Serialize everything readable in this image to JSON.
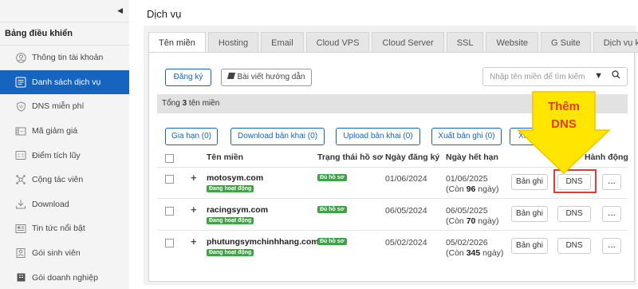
{
  "sidebar": {
    "collapse_icon": "chevron-left-icon",
    "header": "Bảng điều khiển",
    "items": [
      {
        "label": "Thông tin tài khoản",
        "icon": "user-icon",
        "active": false
      },
      {
        "label": "Danh sách dịch vụ",
        "icon": "list-icon",
        "active": true
      },
      {
        "label": "DNS miễn phí",
        "icon": "shield-icon",
        "active": false
      },
      {
        "label": "Mã giảm giá",
        "icon": "coupon-icon",
        "active": false
      },
      {
        "label": "Điểm tích lũy",
        "icon": "points-icon",
        "active": false
      },
      {
        "label": "Cộng tác viên",
        "icon": "network-icon",
        "active": false
      },
      {
        "label": "Download",
        "icon": "download-icon",
        "active": false
      },
      {
        "label": "Tin tức nổi bật",
        "icon": "news-icon",
        "active": false
      },
      {
        "label": "Gói sinh viên",
        "icon": "student-icon",
        "active": false
      },
      {
        "label": "Gói doanh nghiệp",
        "icon": "business-icon",
        "active": false
      }
    ]
  },
  "page_title": "Dịch vụ",
  "tabs": [
    {
      "label": "Tên miền",
      "active": true
    },
    {
      "label": "Hosting",
      "active": false
    },
    {
      "label": "Email",
      "active": false
    },
    {
      "label": "Cloud VPS",
      "active": false
    },
    {
      "label": "Cloud Server",
      "active": false
    },
    {
      "label": "SSL",
      "active": false
    },
    {
      "label": "Website",
      "active": false
    },
    {
      "label": "G Suite",
      "active": false
    },
    {
      "label": "Dịch vụ khác",
      "active": false
    }
  ],
  "toolbar": {
    "register_label": "Đăng ký",
    "guide_label": "Bài viết hướng dẫn",
    "search_placeholder": "Nhập tên miền để tìm kiếm"
  },
  "summary": {
    "prefix": "Tổng ",
    "count": "3",
    "suffix": " tên miền"
  },
  "actions": [
    "Gia hạn (0)",
    "Download bản khai (0)",
    "Upload bản khai (0)",
    "Xuất bản ghi (0)",
    "Xuấ"
  ],
  "table": {
    "headers": [
      "Tên miền",
      "Trạng thái hồ sơ",
      "Ngày đăng ký",
      "Ngày hết hạn",
      "Hành động"
    ],
    "rows": [
      {
        "domain": "motosym.com",
        "status": "Đang hoạt động",
        "doc_status": "Đủ hồ sơ",
        "registered": "01/06/2024",
        "expires": "01/06/2025",
        "remaining_prefix": "(Còn ",
        "remaining": "96",
        "remaining_suffix": " ngày)",
        "btn_records": "Bản ghi",
        "btn_dns": "DNS",
        "more": "..."
      },
      {
        "domain": "racingsym.com",
        "status": "Đang hoạt động",
        "doc_status": "Đủ hồ sơ",
        "registered": "06/05/2024",
        "expires": "06/05/2025",
        "remaining_prefix": "(Còn ",
        "remaining": "70",
        "remaining_suffix": " ngày)",
        "btn_records": "Bản ghi",
        "btn_dns": "DNS",
        "more": "..."
      },
      {
        "domain": "phutungsymchinhhang.com",
        "status": "Đang hoạt động",
        "doc_status": "Đủ hồ sơ",
        "registered": "05/02/2024",
        "expires": "05/02/2026",
        "remaining_prefix": "(Còn ",
        "remaining": "345",
        "remaining_suffix": " ngày)",
        "btn_records": "Bản ghi",
        "btn_dns": "DNS",
        "more": "..."
      }
    ]
  },
  "annotation": {
    "line1": "Thêm",
    "line2": "DNS",
    "arrow_color": "#ffe600",
    "text_color": "#e53935"
  },
  "colors": {
    "primary": "#1565c0",
    "status_green": "#43a047",
    "highlight_red": "#e53935"
  }
}
